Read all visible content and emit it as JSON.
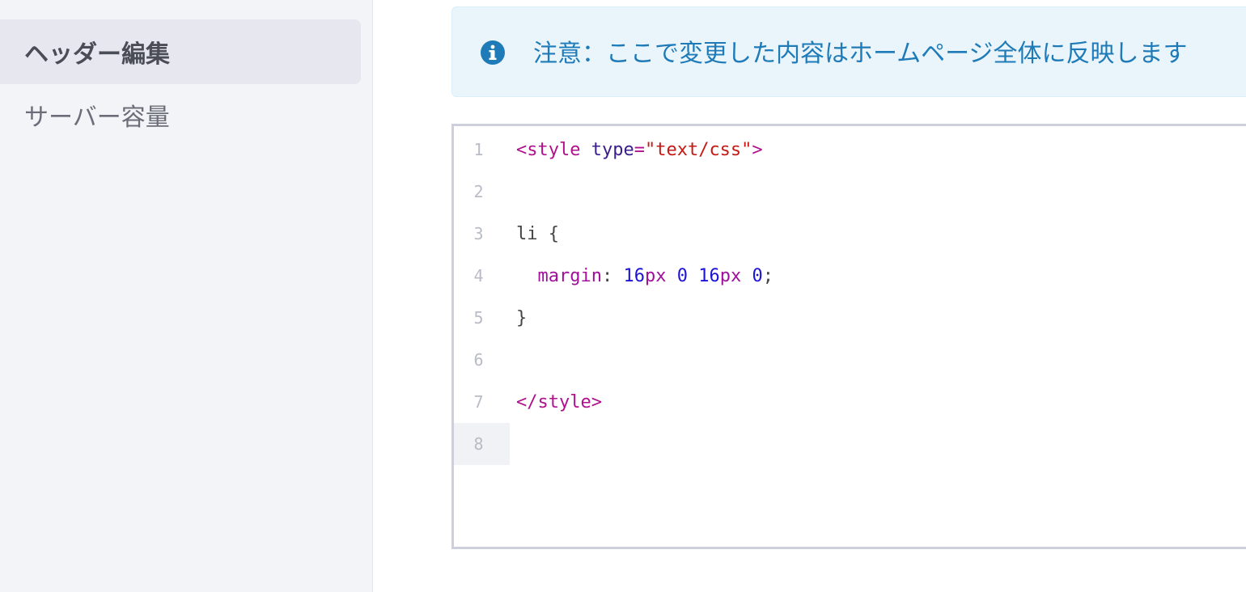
{
  "sidebar": {
    "items": [
      {
        "label": "ヘッダー編集",
        "active": true
      },
      {
        "label": "サーバー容量",
        "active": false
      }
    ]
  },
  "notice": {
    "icon": "info-circle-icon",
    "text": "注意：ここで変更した内容はホームページ全体に反映します",
    "color": "#1e7bb8",
    "background": "#eaf5fb"
  },
  "editor": {
    "language": "css",
    "current_line": 8,
    "line_numbers": [
      "1",
      "2",
      "3",
      "4",
      "5",
      "6",
      "7",
      "8"
    ],
    "lines": [
      {
        "tag_open": "<style",
        "attr": "type",
        "eq": "=",
        "str": "\"text/css\"",
        "tag_close": ">"
      },
      {},
      {
        "plain": "li {"
      },
      {
        "indent": "  ",
        "prop": "margin",
        "colon": ": ",
        "n1": "16",
        "u1": "px",
        "n2": "0",
        "n3": "16",
        "u3": "px",
        "n4": "0",
        "end": ";"
      },
      {
        "plain": "}"
      },
      {},
      {
        "tag": "</style>"
      },
      {}
    ]
  }
}
